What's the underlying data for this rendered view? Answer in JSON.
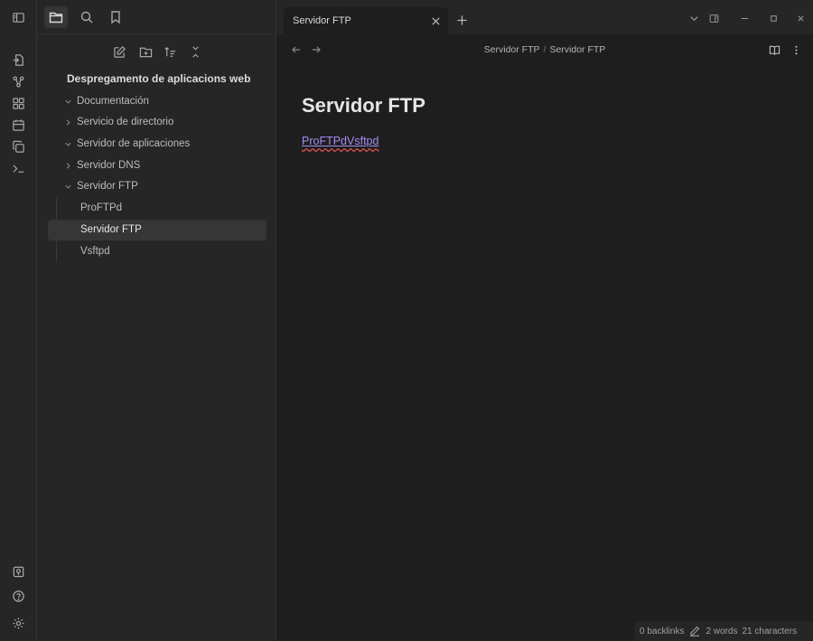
{
  "ribbon": {
    "top_icons": [
      "sidebar-toggle-icon",
      "open-quick-switcher-icon",
      "graph-view-icon",
      "canvas-icon",
      "daily-note-icon",
      "templates-icon",
      "command-palette-icon"
    ],
    "bottom_icons": [
      "vault-switcher-icon",
      "help-icon",
      "settings-icon"
    ]
  },
  "sidebar": {
    "tabs": [
      "files-icon",
      "search-icon",
      "bookmarks-icon"
    ],
    "actions": [
      "new-note-icon",
      "new-folder-icon",
      "sort-icon",
      "collapse-all-icon"
    ],
    "vault_name": "Despregamento de aplicacions web",
    "folders": [
      {
        "label": "Documentación",
        "expanded": true
      },
      {
        "label": "Servicio de directorio",
        "expanded": false
      },
      {
        "label": "Servidor de aplicaciones",
        "expanded": true
      },
      {
        "label": "Servidor DNS",
        "expanded": false
      },
      {
        "label": "Servidor FTP",
        "expanded": true
      }
    ],
    "files": [
      {
        "label": "ProFTPd"
      },
      {
        "label": "Servidor FTP",
        "active": true
      },
      {
        "label": "Vsftpd"
      }
    ]
  },
  "tabbar": {
    "tab_title": "Servidor FTP"
  },
  "main": {
    "breadcrumb": [
      "Servidor FTP",
      "Servidor FTP"
    ],
    "breadcrumb_sep": "/",
    "title": "Servidor FTP",
    "link_text": "ProFTPdVsftpd"
  },
  "statusbar": {
    "backlinks": "0 backlinks",
    "words": "2 words",
    "characters": "21 characters"
  }
}
